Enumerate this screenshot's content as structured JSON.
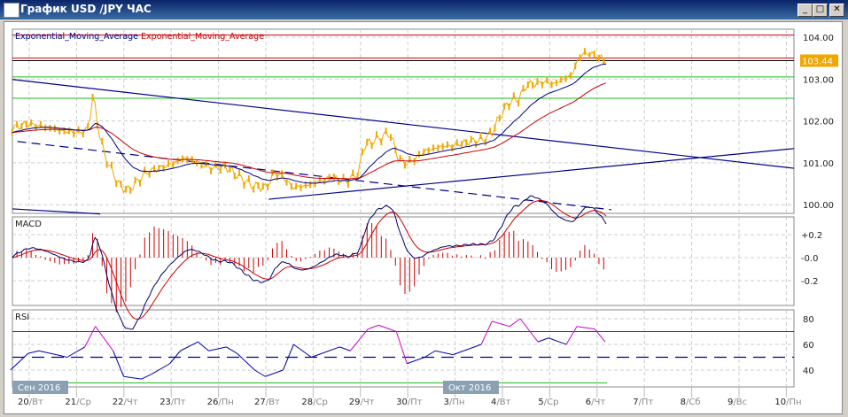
{
  "window": {
    "title": "График USD /JPY  ЧАС",
    "minimize": "_",
    "maximize": "□",
    "close": "✕"
  },
  "legend": {
    "ema1": "Exponential_Moving_Average",
    "ema2": "Exponential_Moving_Average"
  },
  "price_pane": {
    "ticks": [
      "104.00",
      "103.00",
      "102.00",
      "101.00",
      "100.00"
    ],
    "current_price": "103.44"
  },
  "macd_pane": {
    "title": "MACD",
    "ticks": [
      "+0.2",
      "-0.0",
      "-0.2"
    ]
  },
  "rsi_pane": {
    "title": "RSI",
    "ticks": [
      "80",
      "60",
      "40"
    ]
  },
  "month_labels": [
    "Сен 2016",
    "Окт 2016"
  ],
  "dates": [
    [
      "20",
      "Вт"
    ],
    [
      "21",
      "Ср"
    ],
    [
      "22",
      "Чт"
    ],
    [
      "23",
      "Пт"
    ],
    [
      "26",
      "Пн"
    ],
    [
      "27",
      "Вт"
    ],
    [
      "28",
      "Ср"
    ],
    [
      "29",
      "Чт"
    ],
    [
      "30",
      "Пт"
    ],
    [
      "3",
      "Пн"
    ],
    [
      "4",
      "Вт"
    ],
    [
      "5",
      "Ср"
    ],
    [
      "6",
      "Чт"
    ],
    [
      "7",
      "Пт"
    ],
    [
      "8",
      "Сб"
    ],
    [
      "9",
      "Вс"
    ],
    [
      "10",
      "Пн"
    ]
  ],
  "colors": {
    "price": "#f0a800",
    "ema_fast": "#00008b",
    "ema_slow": "#cc0000",
    "trend": "#00008b",
    "green": "#22bb22",
    "red": "#cc0000"
  },
  "chart_data": {
    "type": "line",
    "title": "USD/JPY hourly",
    "ylim": [
      99.8,
      104.2
    ],
    "price": [
      [
        -0.36,
        101.82
      ],
      [
        -0.06,
        101.93
      ],
      [
        0.32,
        101.86
      ],
      [
        0.69,
        101.76
      ],
      [
        1.07,
        101.72
      ],
      [
        1.25,
        101.82
      ],
      [
        1.35,
        102.67
      ],
      [
        1.44,
        101.93
      ],
      [
        1.59,
        101.19
      ],
      [
        1.72,
        100.87
      ],
      [
        1.91,
        100.45
      ],
      [
        2.1,
        100.34
      ],
      [
        2.28,
        100.55
      ],
      [
        2.47,
        100.77
      ],
      [
        2.75,
        100.87
      ],
      [
        3.03,
        100.98
      ],
      [
        3.31,
        101.12
      ],
      [
        3.6,
        100.98
      ],
      [
        3.88,
        100.87
      ],
      [
        4.16,
        100.91
      ],
      [
        4.44,
        100.66
      ],
      [
        4.72,
        100.45
      ],
      [
        5.0,
        100.41
      ],
      [
        5.19,
        100.77
      ],
      [
        5.37,
        100.66
      ],
      [
        5.56,
        100.41
      ],
      [
        5.84,
        100.45
      ],
      [
        6.12,
        100.55
      ],
      [
        6.4,
        100.66
      ],
      [
        6.69,
        100.55
      ],
      [
        6.97,
        100.77
      ],
      [
        7.06,
        101.4
      ],
      [
        7.25,
        101.51
      ],
      [
        7.43,
        101.61
      ],
      [
        7.62,
        101.72
      ],
      [
        7.81,
        101.08
      ],
      [
        8.0,
        100.98
      ],
      [
        8.18,
        101.12
      ],
      [
        8.37,
        101.29
      ],
      [
        8.56,
        101.34
      ],
      [
        8.75,
        101.4
      ],
      [
        8.93,
        101.4
      ],
      [
        9.12,
        101.46
      ],
      [
        9.31,
        101.51
      ],
      [
        9.59,
        101.55
      ],
      [
        9.78,
        101.72
      ],
      [
        9.96,
        102.14
      ],
      [
        10.15,
        102.46
      ],
      [
        10.34,
        102.52
      ],
      [
        10.52,
        102.88
      ],
      [
        10.71,
        102.88
      ],
      [
        10.9,
        102.94
      ],
      [
        11.09,
        102.88
      ],
      [
        11.27,
        102.99
      ],
      [
        11.46,
        103.09
      ],
      [
        11.65,
        103.58
      ],
      [
        11.84,
        103.62
      ],
      [
        12.02,
        103.51
      ],
      [
        12.21,
        103.44
      ]
    ],
    "hlines": [
      {
        "price": 104.05,
        "color": "red"
      },
      {
        "price": 103.5,
        "color": "red"
      },
      {
        "price": 103.44,
        "color": "black"
      },
      {
        "price": 103.05,
        "color": "green"
      },
      {
        "price": 102.54,
        "color": "green"
      }
    ],
    "trendlines": [
      {
        "from": [
          -0.36,
          102.99
        ],
        "to": [
          16.16,
          100.87
        ],
        "style": "solid"
      },
      {
        "from": [
          5.06,
          100.13
        ],
        "to": [
          16.16,
          101.34
        ],
        "style": "solid"
      },
      {
        "from": [
          -0.25,
          101.51
        ],
        "to": [
          12.3,
          99.88
        ],
        "style": "dashed"
      },
      {
        "from": [
          -0.36,
          99.9
        ],
        "to": [
          1.5,
          99.78
        ],
        "style": "solid"
      }
    ],
    "rsi": [
      40,
      53,
      55,
      52,
      50,
      58,
      74,
      55,
      35,
      33,
      37,
      45,
      55,
      62,
      55,
      58,
      53,
      40,
      35,
      40,
      60,
      50,
      53,
      58,
      55,
      72,
      75,
      70,
      45,
      50,
      55,
      52,
      55,
      60,
      78,
      74,
      80,
      62,
      65,
      60,
      74,
      72,
      62
    ],
    "rsi_levels": {
      "upper": 70,
      "middle": 50,
      "lower": 30
    }
  }
}
